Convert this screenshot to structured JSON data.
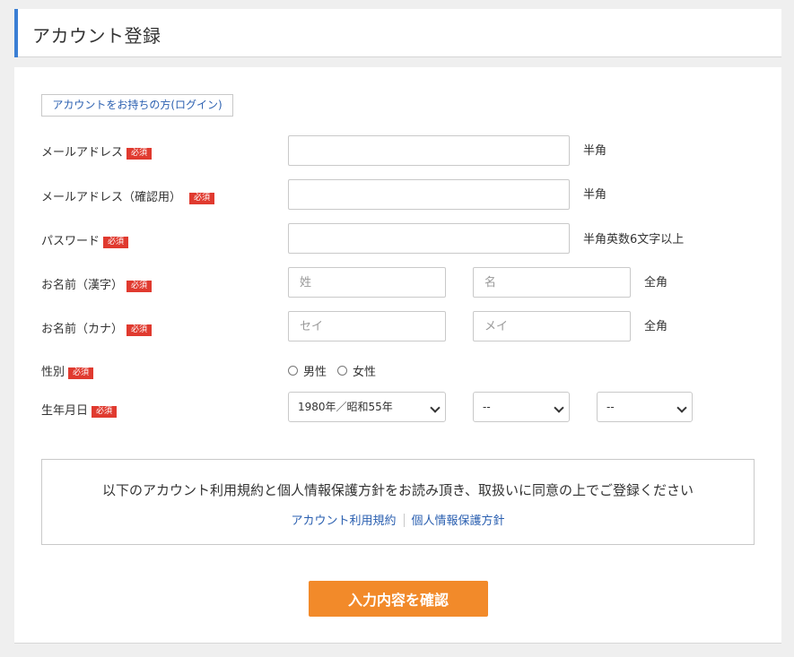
{
  "header": {
    "title": "アカウント登録"
  },
  "login_link": "アカウントをお持ちの方(ログイン)",
  "required_badge": "必須",
  "fields": {
    "email": {
      "label": "メールアドレス",
      "value": "",
      "note": "半角"
    },
    "email_confirm": {
      "label": "メールアドレス（確認用）",
      "value": "",
      "note": "半角"
    },
    "password": {
      "label": "パスワード",
      "value": "",
      "note": "半角英数6文字以上"
    },
    "name_kanji": {
      "label": "お名前（漢字）",
      "last_placeholder": "姓",
      "first_placeholder": "名",
      "note": "全角"
    },
    "name_kana": {
      "label": "お名前（カナ）",
      "last_placeholder": "セイ",
      "first_placeholder": "メイ",
      "note": "全角"
    },
    "gender": {
      "label": "性別",
      "options": [
        "男性",
        "女性"
      ]
    },
    "birthdate": {
      "label": "生年月日",
      "year": "1980年／昭和55年",
      "month": "--",
      "day": "--"
    }
  },
  "agreement": {
    "text": "以下のアカウント利用規約と個人情報保護方針をお読み頂き、取扱いに同意の上でご登録ください",
    "terms_link": "アカウント利用規約",
    "privacy_link": "個人情報保護方針"
  },
  "confirm_button": "入力内容を確認",
  "colors": {
    "accent": "#3b7fd4",
    "required": "#e03a2f",
    "button": "#f28a2a",
    "link": "#2a5fb0"
  }
}
